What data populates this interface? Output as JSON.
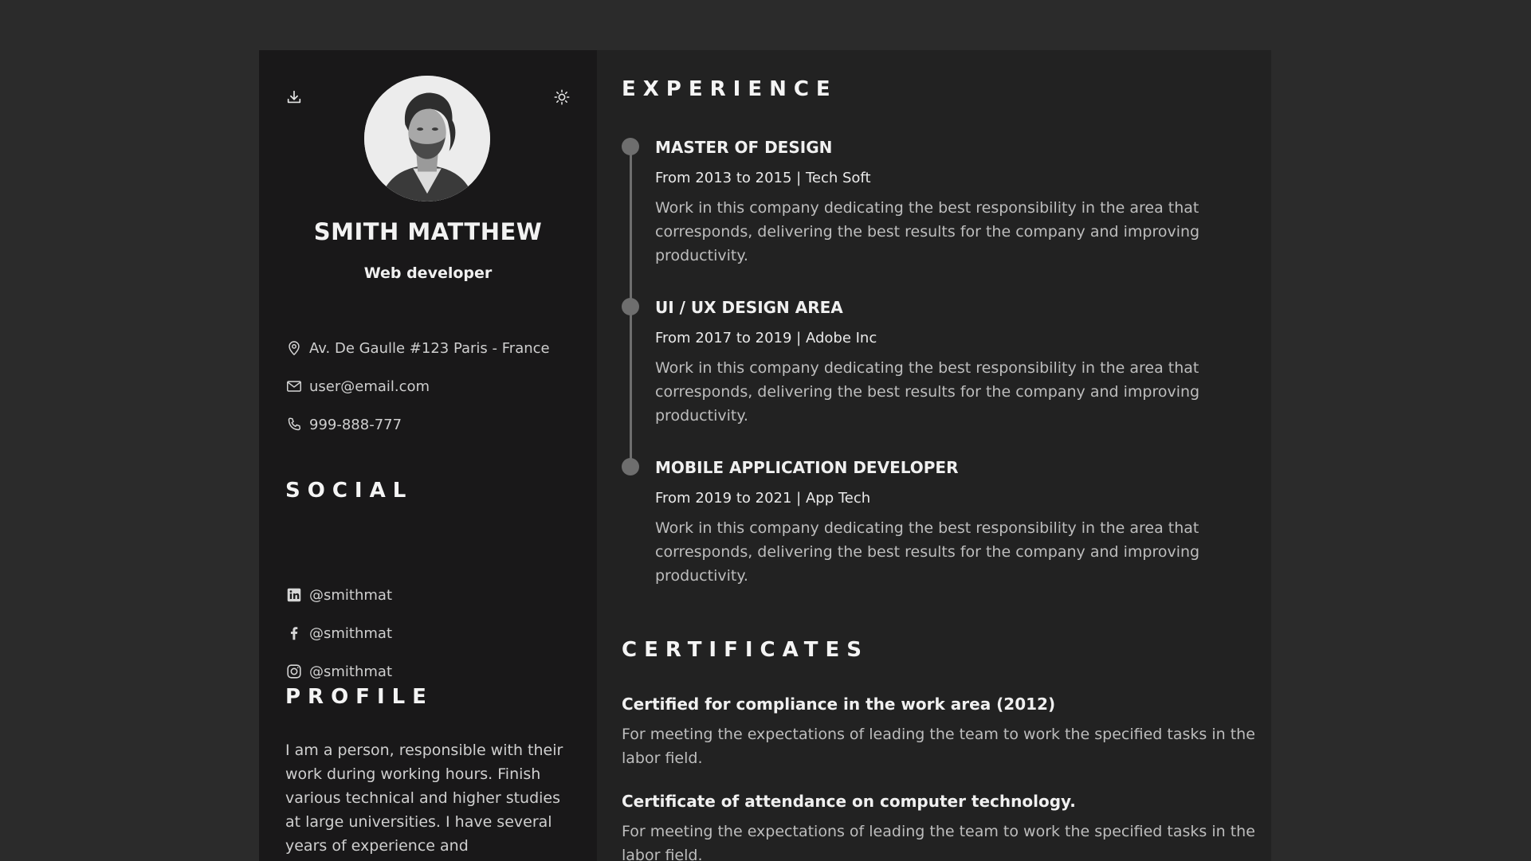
{
  "header": {
    "name": "SMITH MATTHEW",
    "role": "Web developer"
  },
  "toolbar": {
    "download_icon": "download-icon",
    "theme_icon": "sun-icon"
  },
  "contact": {
    "address": "Av. De Gaulle #123 Paris - France",
    "email": "user@email.com",
    "phone": "999-888-777"
  },
  "social": {
    "title": "SOCIAL",
    "items": [
      {
        "icon": "linkedin-icon",
        "handle": "@smithmat"
      },
      {
        "icon": "facebook-icon",
        "handle": "@smithmat"
      },
      {
        "icon": "instagram-icon",
        "handle": "@smithmat"
      }
    ]
  },
  "profile": {
    "title": "PROFILE",
    "text": "I am a person, responsible with their work during working hours. Finish various technical and higher studies at large universities. I have several years of experience and"
  },
  "experience": {
    "title": "EXPERIENCE",
    "items": [
      {
        "title": "MASTER OF DESIGN",
        "meta": "From 2013 to 2015 | Tech Soft",
        "description": "Work in this company dedicating the best responsibility in the area that corresponds, delivering the best results for the company and improving productivity."
      },
      {
        "title": "UI / UX DESIGN AREA",
        "meta": "From 2017 to 2019 | Adobe Inc",
        "description": "Work in this company dedicating the best responsibility in the area that corresponds, delivering the best results for the company and improving productivity."
      },
      {
        "title": "MOBILE APPLICATION DEVELOPER",
        "meta": "From 2019 to 2021 | App Tech",
        "description": "Work in this company dedicating the best responsibility in the area that corresponds, delivering the best results for the company and improving productivity."
      }
    ]
  },
  "certificates": {
    "title": "CERTIFICATES",
    "items": [
      {
        "name": "Certified for compliance in the work area (2012)",
        "description": "For meeting the expectations of leading the team to work the specified tasks in the labor field."
      },
      {
        "name": "Certificate of attendance on computer technology.",
        "description": "For meeting the expectations of leading the team to work the specified tasks in the labor field."
      }
    ]
  },
  "colors": {
    "page_bg": "#2b2b2b",
    "left_bg": "#191819",
    "right_bg": "#222222",
    "timeline": "#6e6e6e"
  }
}
